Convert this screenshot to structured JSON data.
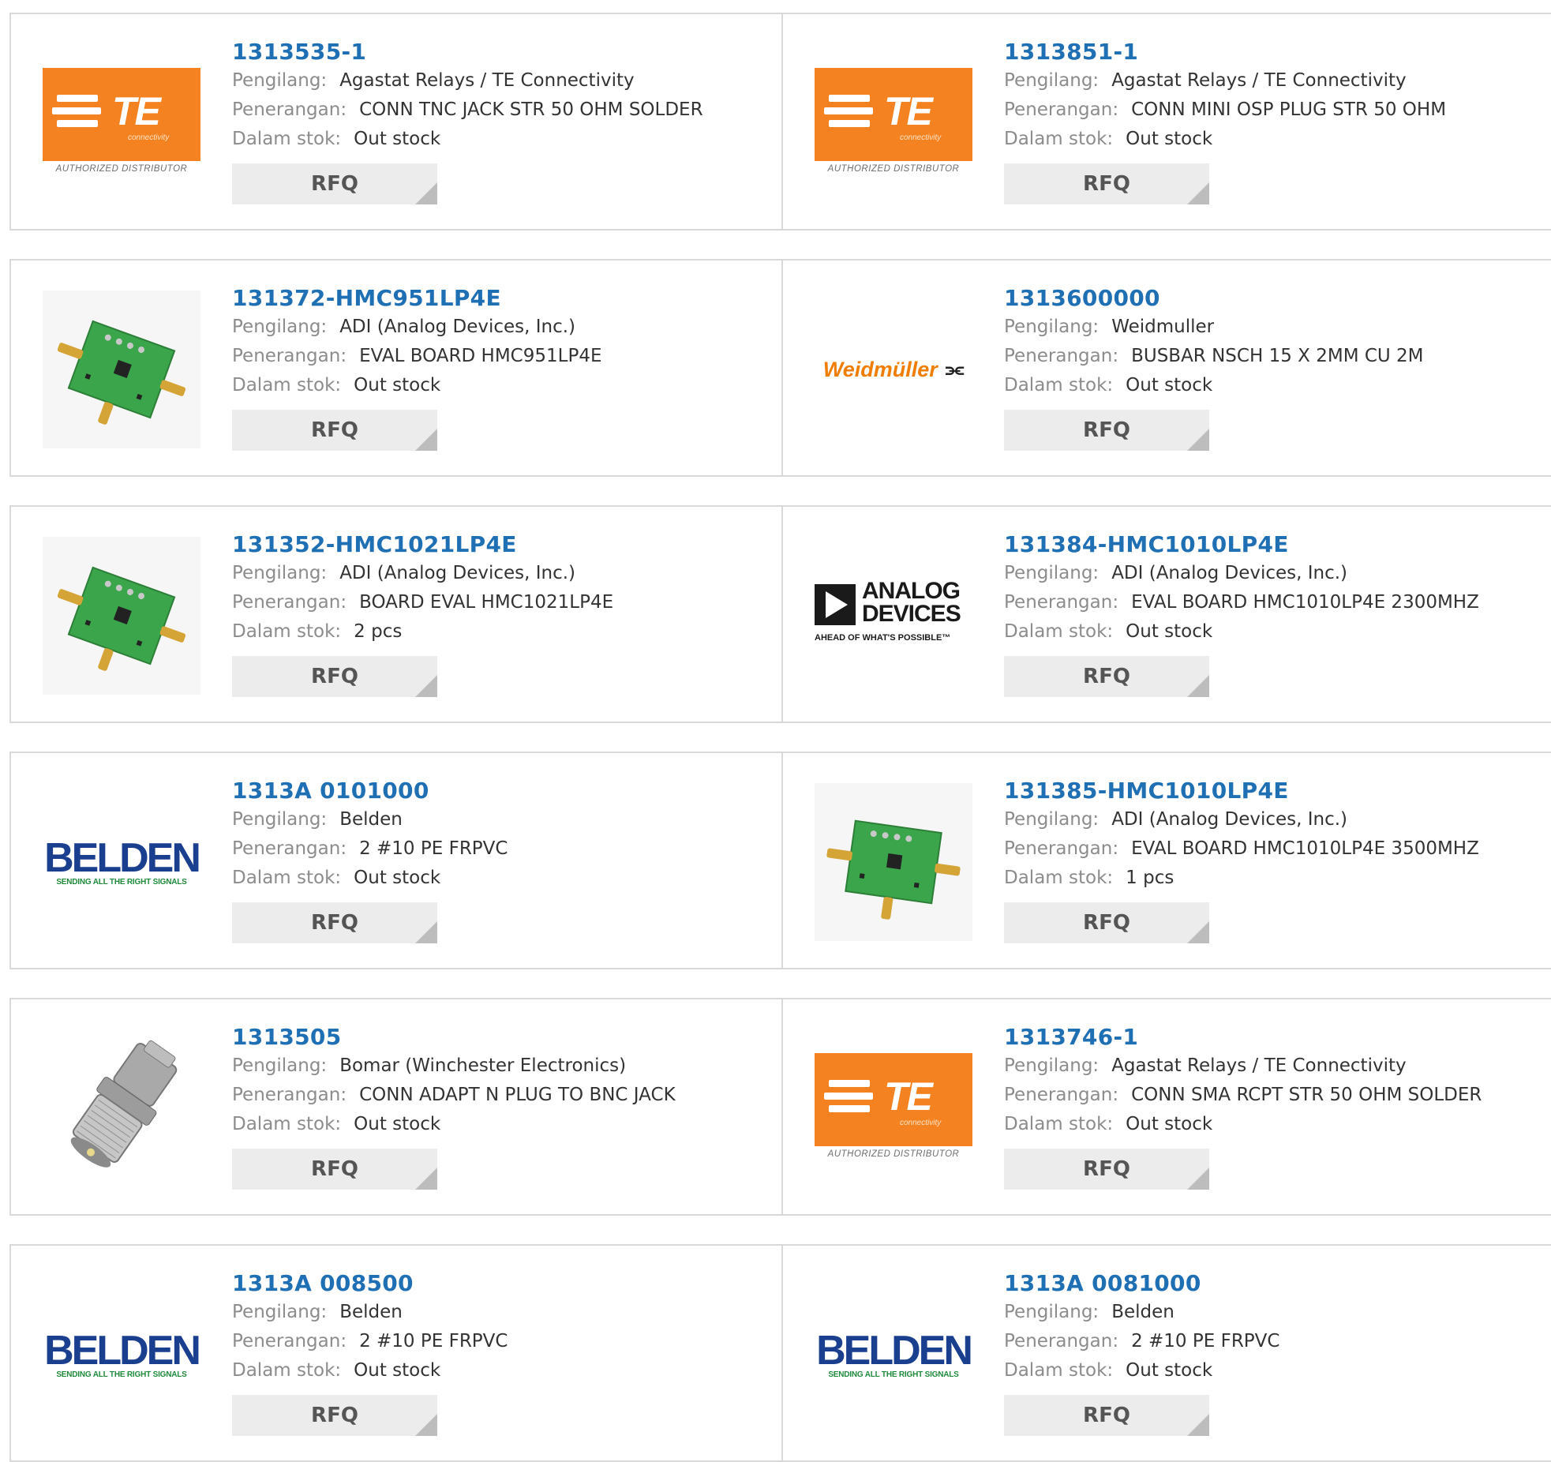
{
  "labels": {
    "manufacturer": "Pengilang:",
    "description": "Penerangan:",
    "stock": "Dalam stok:",
    "rfq": "RFQ"
  },
  "colors": {
    "part_link": "#1f6fb5",
    "te_orange": "#f58220",
    "rfq_bg": "#ececec"
  },
  "products": [
    {
      "part": "1313535-1",
      "manufacturer": "Agastat Relays / TE Connectivity",
      "description": "CONN TNC JACK STR 50 OHM SOLDER",
      "stock": "Out stock",
      "logo": "te-connectivity-logo",
      "logo_text": "TE",
      "logo_sub": "connectivity",
      "logo_note": "AUTHORIZED DISTRIBUTOR"
    },
    {
      "part": "1313851-1",
      "manufacturer": "Agastat Relays / TE Connectivity",
      "description": "CONN MINI OSP PLUG STR 50 OHM",
      "stock": "Out stock",
      "logo": "te-connectivity-logo",
      "logo_text": "TE",
      "logo_sub": "connectivity",
      "logo_note": "AUTHORIZED DISTRIBUTOR"
    },
    {
      "part": "131372-HMC951LP4E",
      "manufacturer": "ADI (Analog Devices, Inc.)",
      "description": "EVAL BOARD HMC951LP4E",
      "stock": "Out stock",
      "logo": "eval-board-photo"
    },
    {
      "part": "1313600000",
      "manufacturer": "Weidmuller",
      "description": "BUSBAR NSCH 15 X 2MM CU 2M",
      "stock": "Out stock",
      "logo": "weidmuller-logo",
      "logo_text": "Weidmüller"
    },
    {
      "part": "131352-HMC1021LP4E",
      "manufacturer": "ADI (Analog Devices, Inc.)",
      "description": "BOARD EVAL HMC1021LP4E",
      "stock": "2 pcs",
      "logo": "eval-board-photo"
    },
    {
      "part": "131384-HMC1010LP4E",
      "manufacturer": "ADI (Analog Devices, Inc.)",
      "description": "EVAL BOARD HMC1010LP4E 2300MHZ",
      "stock": "Out stock",
      "logo": "analog-devices-logo",
      "logo_text": "ANALOG DEVICES",
      "logo_note": "AHEAD OF WHAT'S POSSIBLE™"
    },
    {
      "part": "1313A 0101000",
      "manufacturer": "Belden",
      "description": "2 #10 PE FRPVC",
      "stock": "Out stock",
      "logo": "belden-logo",
      "logo_text": "BELDEN",
      "logo_note": "SENDING ALL THE RIGHT SIGNALS"
    },
    {
      "part": "131385-HMC1010LP4E",
      "manufacturer": "ADI (Analog Devices, Inc.)",
      "description": "EVAL BOARD HMC1010LP4E 3500MHZ",
      "stock": "1 pcs",
      "logo": "eval-board-photo"
    },
    {
      "part": "1313505",
      "manufacturer": "Bomar (Winchester Electronics)",
      "description": "CONN ADAPT N PLUG TO BNC JACK",
      "stock": "Out stock",
      "logo": "rf-adapter-photo"
    },
    {
      "part": "1313746-1",
      "manufacturer": "Agastat Relays / TE Connectivity",
      "description": "CONN SMA RCPT STR 50 OHM SOLDER",
      "stock": "Out stock",
      "logo": "te-connectivity-logo",
      "logo_text": "TE",
      "logo_sub": "connectivity",
      "logo_note": "AUTHORIZED DISTRIBUTOR"
    },
    {
      "part": "1313A 008500",
      "manufacturer": "Belden",
      "description": "2 #10 PE FRPVC",
      "stock": "Out stock",
      "logo": "belden-logo",
      "logo_text": "BELDEN",
      "logo_note": "SENDING ALL THE RIGHT SIGNALS"
    },
    {
      "part": "1313A 0081000",
      "manufacturer": "Belden",
      "description": "2 #10 PE FRPVC",
      "stock": "Out stock",
      "logo": "belden-logo",
      "logo_text": "BELDEN",
      "logo_note": "SENDING ALL THE RIGHT SIGNALS"
    }
  ]
}
